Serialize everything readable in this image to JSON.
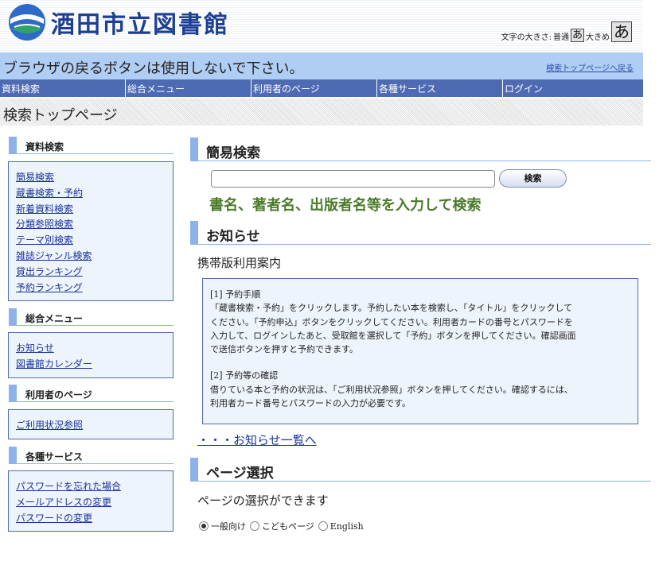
{
  "header": {
    "site_title": "酒田市立図書館",
    "font_size": {
      "label": "文字の大きさ:",
      "normal_label": "普通",
      "normal_glyph": "あ",
      "large_label": "大きめ",
      "large_glyph": "あ"
    }
  },
  "notice_bar": {
    "text": "ブラウザの戻るボタンは使用しないで下さい。",
    "link": "検索トップページへ戻る"
  },
  "nav": [
    "資料検索",
    "総合メニュー",
    "利用者のページ",
    "各種サービス",
    "ログイン"
  ],
  "page_title": "検索トップページ",
  "sidebar": {
    "sections": [
      {
        "title": "資料検索",
        "links": [
          "簡易検索",
          "蔵書検索・予約",
          "新着資料検索",
          "分類参照検索",
          "テーマ別検索",
          "雑誌ジャンル検索",
          "貸出ランキング",
          "予約ランキング"
        ]
      },
      {
        "title": "総合メニュー",
        "links": [
          "お知らせ",
          "図書館カレンダー"
        ]
      },
      {
        "title": "利用者のページ",
        "links": [
          "ご利用状況参照"
        ]
      },
      {
        "title": "各種サービス",
        "links": [
          "パスワードを忘れた場合",
          "メールアドレスの変更",
          "パスワードの変更"
        ]
      }
    ]
  },
  "simple_search": {
    "title": "簡易検索",
    "input_value": "",
    "button": "検索",
    "hint": "書名、著者名、出版者名等を入力して検索"
  },
  "news": {
    "title": "お知らせ",
    "subtitle": "携帯版利用案内",
    "paragraphs": [
      {
        "heading": "[1] 予約手順",
        "lines": [
          "「蔵書検索・予約」をクリックします。予約したい本を検索し、「タイトル」をクリックして",
          "ください。「予約申込」ボタンをクリックしてください。利用者カードの番号とパスワードを",
          "入力して、ログインしたあと、受取館を選択して「予約」ボタンを押してください。確認画面",
          "で送信ボタンを押すと予約できます。"
        ]
      },
      {
        "heading": "[2] 予約等の確認",
        "lines": [
          "借りている本と予約の状況は、「ご利用状況参照」ボタンを押してください。確認するには、",
          "利用者カード番号とパスワードの入力が必要です。"
        ]
      }
    ],
    "all_link": "・・・お知らせ一覧へ"
  },
  "page_select": {
    "title": "ページ選択",
    "description": "ページの選択ができます",
    "options": [
      {
        "label": "一般向け",
        "checked": true
      },
      {
        "label": "こどもページ",
        "checked": false
      },
      {
        "label": "English",
        "checked": false
      }
    ]
  },
  "colors": {
    "title_blue": "#1c3f93",
    "nav_blue": "#4e6ab3",
    "notice_bar": "#b0cdf3",
    "accent": "#8db2ea",
    "hint_green": "#4a7a2a",
    "box_bg": "#eef4fc"
  },
  "icons": [
    "library-logo-icon"
  ]
}
